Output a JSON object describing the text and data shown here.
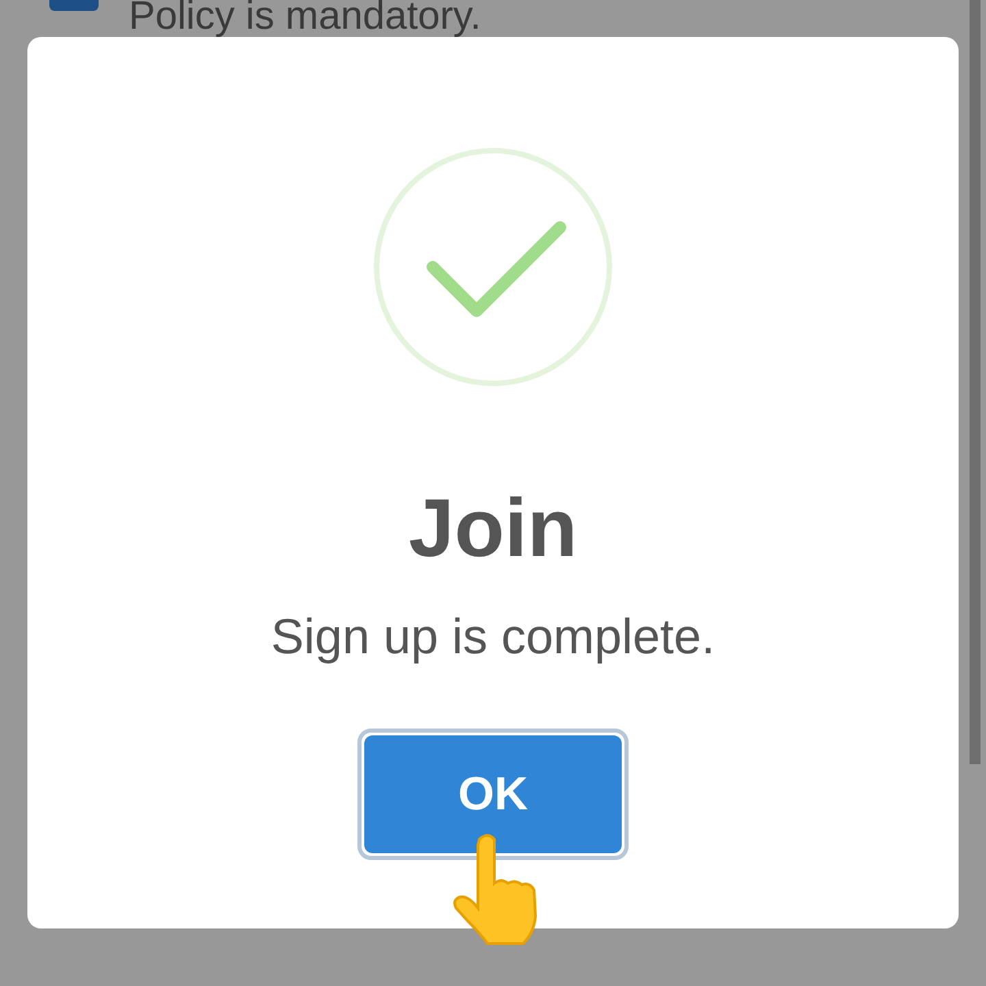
{
  "background": {
    "agreement": {
      "checked": true,
      "text": "Policy is mandatory."
    }
  },
  "dialog": {
    "title": "Join",
    "message": "Sign up is complete.",
    "button": "OK"
  }
}
